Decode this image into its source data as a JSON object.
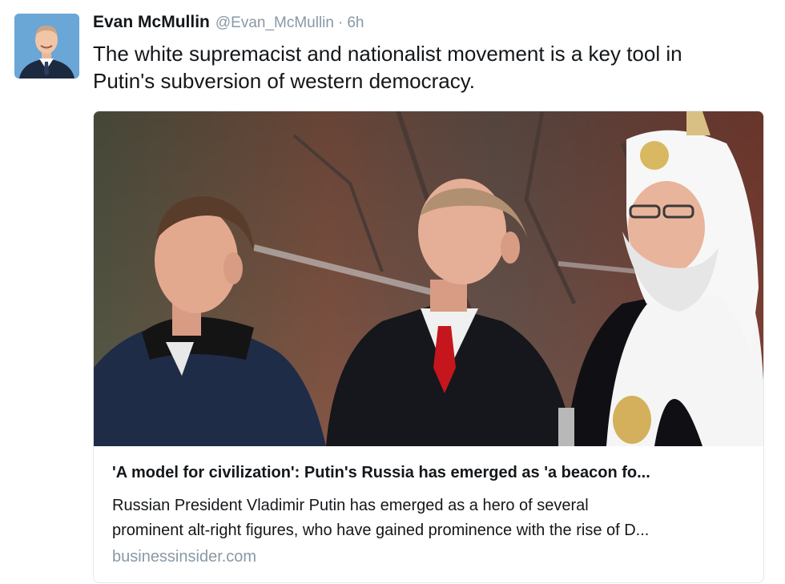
{
  "tweet": {
    "author": {
      "name": "Evan McMullin",
      "handle": "@Evan_McMullin",
      "separator": "·",
      "time": "6h",
      "avatar_icon": "profile-photo-icon"
    },
    "text_line1": "The white supremacist and nationalist movement is a key tool in",
    "text_line2": "Putin's subversion of western democracy."
  },
  "card": {
    "image_icon": "news-photo-icon",
    "title": "'A model for civilization': Putin's Russia has emerged as 'a beacon fo...",
    "description_line1": "Russian President Vladimir Putin has emerged as a hero of several",
    "description_line2": "prominent alt-right figures, who have gained prominence with the rise of D...",
    "domain": "businessinsider.com"
  },
  "colors": {
    "text": "#14171a",
    "muted": "#8899a6",
    "card_border": "#e1e8ed",
    "background": "#ffffff"
  }
}
